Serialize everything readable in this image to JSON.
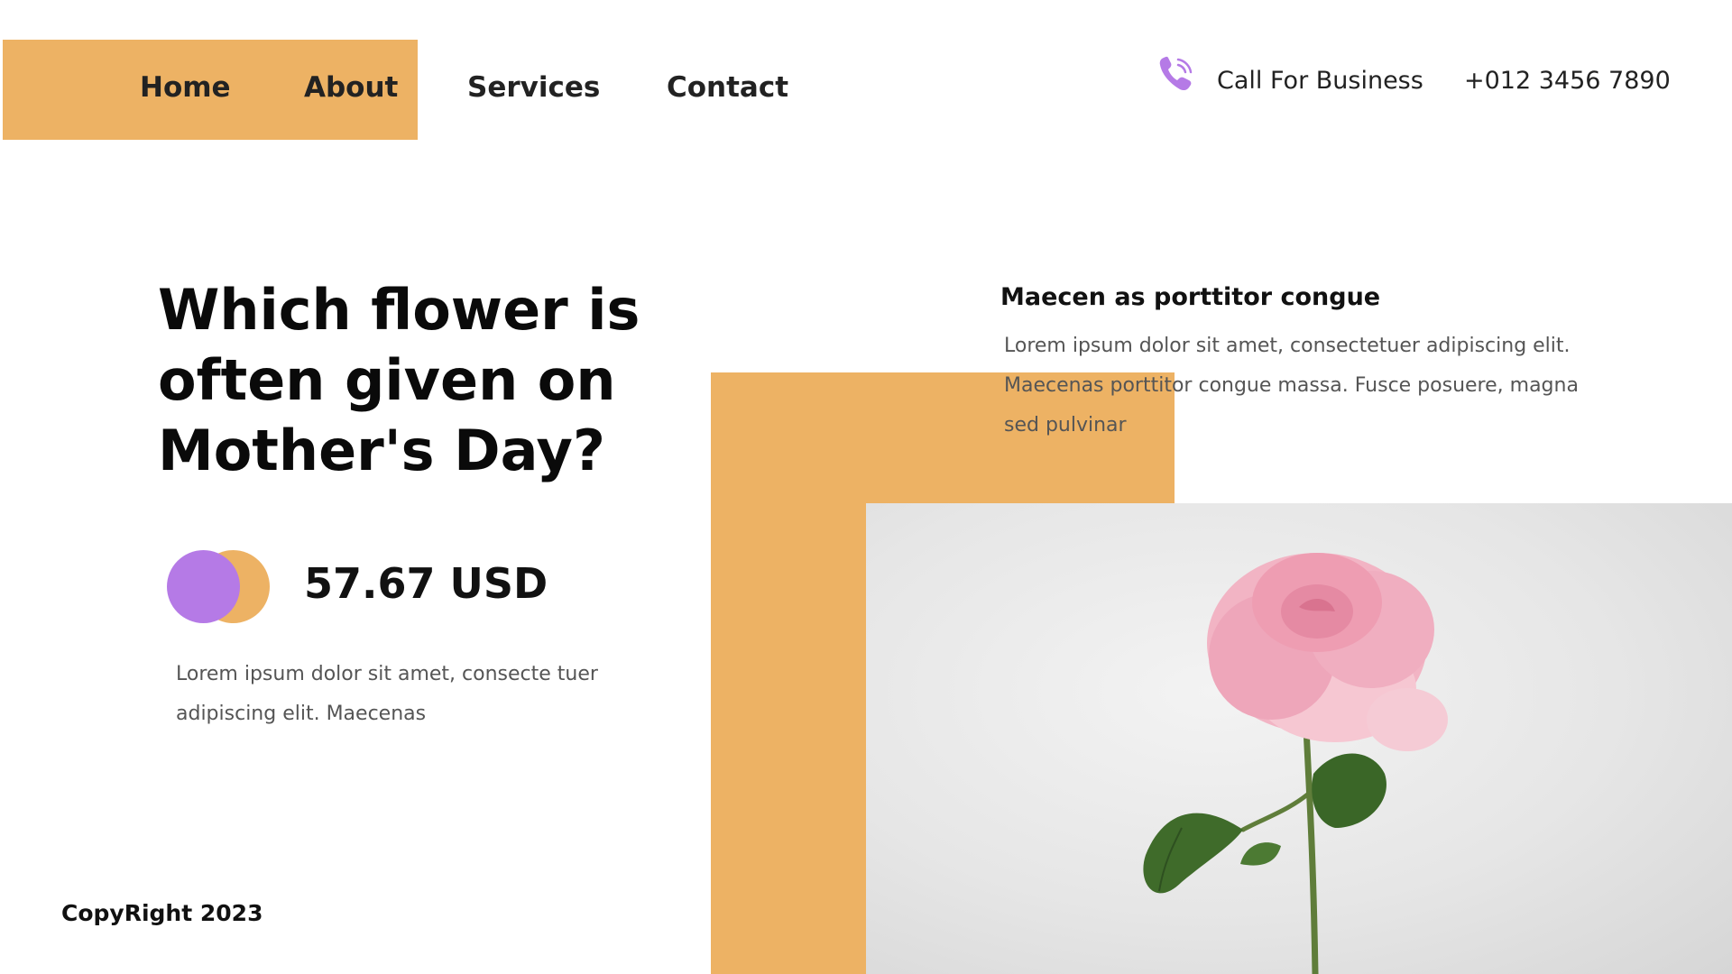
{
  "nav": {
    "items": [
      {
        "label": "Home"
      },
      {
        "label": "About"
      },
      {
        "label": "Services"
      },
      {
        "label": "Contact"
      }
    ]
  },
  "contact": {
    "icon": "phone-icon",
    "label": "Call For Business",
    "phone": "+012 3456 7890"
  },
  "hero": {
    "title": "Which flower is often given on Mother's Day?",
    "price": "57.67 USD",
    "description": "Lorem ipsum dolor sit amet, consecte tuer adipiscing elit. Maecenas"
  },
  "feature": {
    "heading": "Maecen as porttitor congue",
    "text": "Lorem ipsum dolor sit amet, consectetuer adipiscing elit. Maecenas porttitor congue massa. Fusce posuere, magna sed pulvinar"
  },
  "footer": {
    "copyright": "CopyRight 2023"
  },
  "colors": {
    "accent_orange": "#EDB264",
    "accent_purple": "#B57AE6"
  }
}
